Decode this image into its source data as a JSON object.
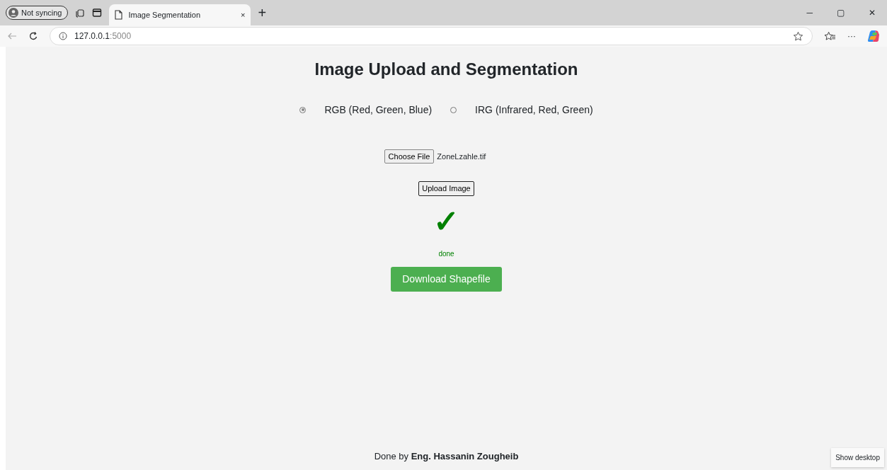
{
  "browser": {
    "profile": "Not syncing",
    "tab_title": "Image Segmentation",
    "tab_close": "×",
    "new_tab": "+",
    "url_host": "127.0.0.1",
    "url_port": ":5000",
    "window_controls": [
      "─",
      "▢",
      "✕"
    ],
    "more": "···"
  },
  "page": {
    "title": "Image Upload and Segmentation",
    "modes": [
      {
        "label": "RGB (Red, Green, Blue)",
        "selected": true
      },
      {
        "label": "IRG (Infrared, Red, Green)",
        "selected": false
      }
    ],
    "file_button": "Choose File",
    "file_name": "ZoneLzahle.tif",
    "upload_button": "Upload Image",
    "status_icon": "✓",
    "status": "done",
    "download_button": "Download Shapefile",
    "footer": "Done by **Eng. Hassanin Zougheib**"
  },
  "tooltip": "Show desktop"
}
